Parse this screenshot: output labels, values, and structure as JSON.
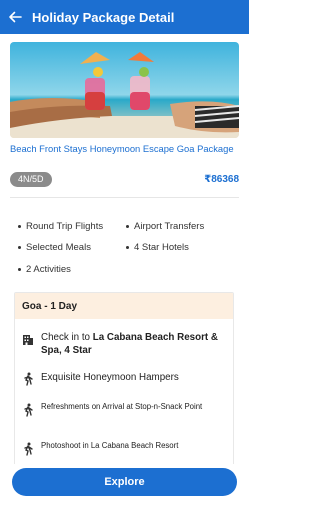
{
  "header": {
    "title": "Holiday Package Detail",
    "back_icon": "arrow-left-icon"
  },
  "package": {
    "title": "Beach Front Stays Honeymoon Escape Goa Package",
    "duration": "4N/5D",
    "price": "₹86368"
  },
  "inclusions": [
    "Round Trip Flights",
    "Airport Transfers",
    "Selected Meals",
    "4 Star Hotels",
    "2 Activities"
  ],
  "itinerary": {
    "day_title": "Goa - 1 Day",
    "items": [
      {
        "icon": "hotel-building-icon",
        "text_prefix": "Check in to ",
        "text_bold": "La Cabana Beach Resort & Spa, 4 Star"
      },
      {
        "icon": "person-walking-icon",
        "text": "Exquisite Honeymoon Hampers"
      },
      {
        "icon": "person-walking-icon",
        "text": "Refreshments on Arrival at Stop-n-Snack Point"
      },
      {
        "icon": "person-walking-icon",
        "text": "Photoshoot in La Cabana Beach Resort"
      }
    ]
  },
  "cta": {
    "label": "Explore"
  },
  "colors": {
    "primary": "#1c6fd1",
    "day_header_bg": "#fdefe0",
    "badge": "#8b8b8b"
  }
}
